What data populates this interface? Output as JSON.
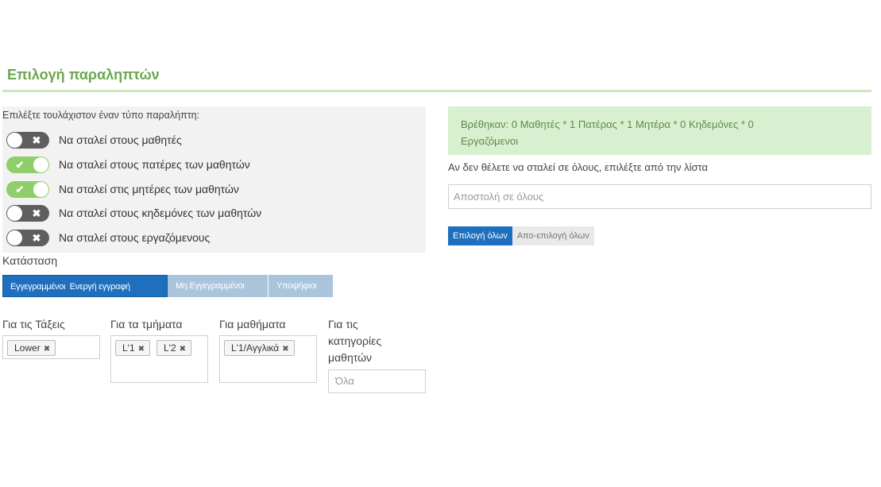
{
  "header": {
    "title": "Επιλογή παραληπτών"
  },
  "recipient_types": {
    "hint": "Επιλέξτε τουλάχιστον έναν τύπο παραλήπτη:",
    "items": [
      {
        "label": "Να σταλεί στους μαθητές",
        "on": false,
        "icon": "✖"
      },
      {
        "label": "Να σταλεί στους πατέρες των μαθητών",
        "on": true,
        "icon": "✔"
      },
      {
        "label": "Να σταλεί στις μητέρες των μαθητών",
        "on": true,
        "icon": "✔"
      },
      {
        "label": "Να σταλεί στους κηδεμόνες των μαθητών",
        "on": false,
        "icon": "✖"
      },
      {
        "label": "Να σταλεί στους εργαζόμενους",
        "on": false,
        "icon": "✖"
      }
    ],
    "colors": {
      "on": "#8fce6a",
      "off": "#5e5e5e"
    }
  },
  "status": {
    "label": "Κατάσταση",
    "buttons": [
      {
        "label": "Εγγεγραμμένοι  Ενεργή εγγραφή",
        "active": true
      },
      {
        "label": "Μη Εγγεγραμμένοι",
        "active": false
      },
      {
        "label": "Υποψήφιοι",
        "active": false
      }
    ]
  },
  "filters": {
    "classes": {
      "label": "Για τις Τάξεις",
      "tags": [
        "Lower"
      ]
    },
    "sections": {
      "label": "Για τα τμήματα",
      "tags": [
        "L'1",
        "L'2"
      ]
    },
    "courses": {
      "label": "Για μαθήματα",
      "tags": [
        "L'1/Αγγλικά"
      ]
    },
    "categories": {
      "label_lines": [
        "Για τις",
        "κατηγορίες",
        "μαθητών"
      ],
      "placeholder": "Όλα"
    }
  },
  "results": {
    "found_line1": "Βρέθηκαν: 0 Μαθητές * 1 Πατέρας * 1 Μητέρα * 0 Κηδεμόνες * 0",
    "found_line2": "Εργαζόμενοι",
    "hint": "Αν δεν θέλετε να σταλεί σε όλους, επιλέξτε από την λίστα",
    "placeholder": "Αποστολή σε όλους",
    "select_all": "Επιλογή όλων",
    "deselect_all": "Απο-επιλογή όλων"
  },
  "icons": {
    "remove_tag": "close-icon",
    "toggle_on": "check-icon",
    "toggle_off": "cross-icon"
  },
  "accent_color": "#6aa84f"
}
